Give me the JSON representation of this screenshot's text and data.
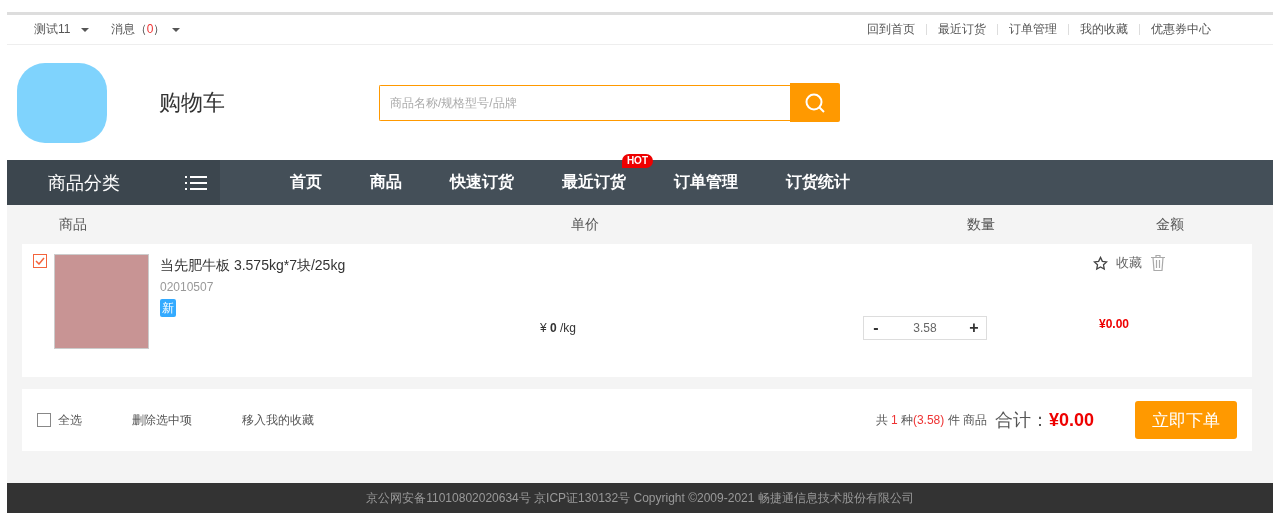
{
  "top_bar": {
    "user": "测试11",
    "messages_label": "消息",
    "paren_open": "（",
    "messages_count": "0",
    "paren_close": "）",
    "links": [
      "回到首页",
      "最近订货",
      "订单管理",
      "我的收藏",
      "优惠券中心"
    ]
  },
  "header": {
    "title": "购物车",
    "search": {
      "placeholder": "商品名称/规格型号/品牌"
    }
  },
  "nav": {
    "category_label": "商品分类",
    "items": [
      {
        "label": "首页"
      },
      {
        "label": "商品"
      },
      {
        "label": "快速订货"
      },
      {
        "label": "最近订货",
        "badge": "HOT"
      },
      {
        "label": "订单管理"
      },
      {
        "label": "订货统计"
      }
    ]
  },
  "cart": {
    "columns": [
      "商品",
      "单价",
      "数量",
      "金额"
    ],
    "items": [
      {
        "checked": true,
        "name": "当先肥牛板 3.575kg*7块/25kg",
        "code": "02010507",
        "tag": "新",
        "price_symbol": "¥",
        "price": "0",
        "unit": "/kg",
        "minus": "-",
        "quantity": "3.58",
        "plus": "+",
        "amount": "¥0.00",
        "favorite_label": "收藏"
      }
    ]
  },
  "footer_bar": {
    "select_all": {
      "label": "全选",
      "checked": false
    },
    "delete_label": "删除选中项",
    "move_label": "移入我的收藏",
    "summary": {
      "prefix": "共",
      "kinds": "1",
      "middle": "种",
      "quantity": "(3.58)",
      "suffix": "件 商品"
    },
    "total_label": "合计：",
    "total": "¥0.00",
    "submit": "立即下单"
  },
  "footer": {
    "text": "京公网安备11010802020634号 京ICP证130132号 Copyright ©2009-2021 畅捷通信息技术股份有限公司"
  }
}
